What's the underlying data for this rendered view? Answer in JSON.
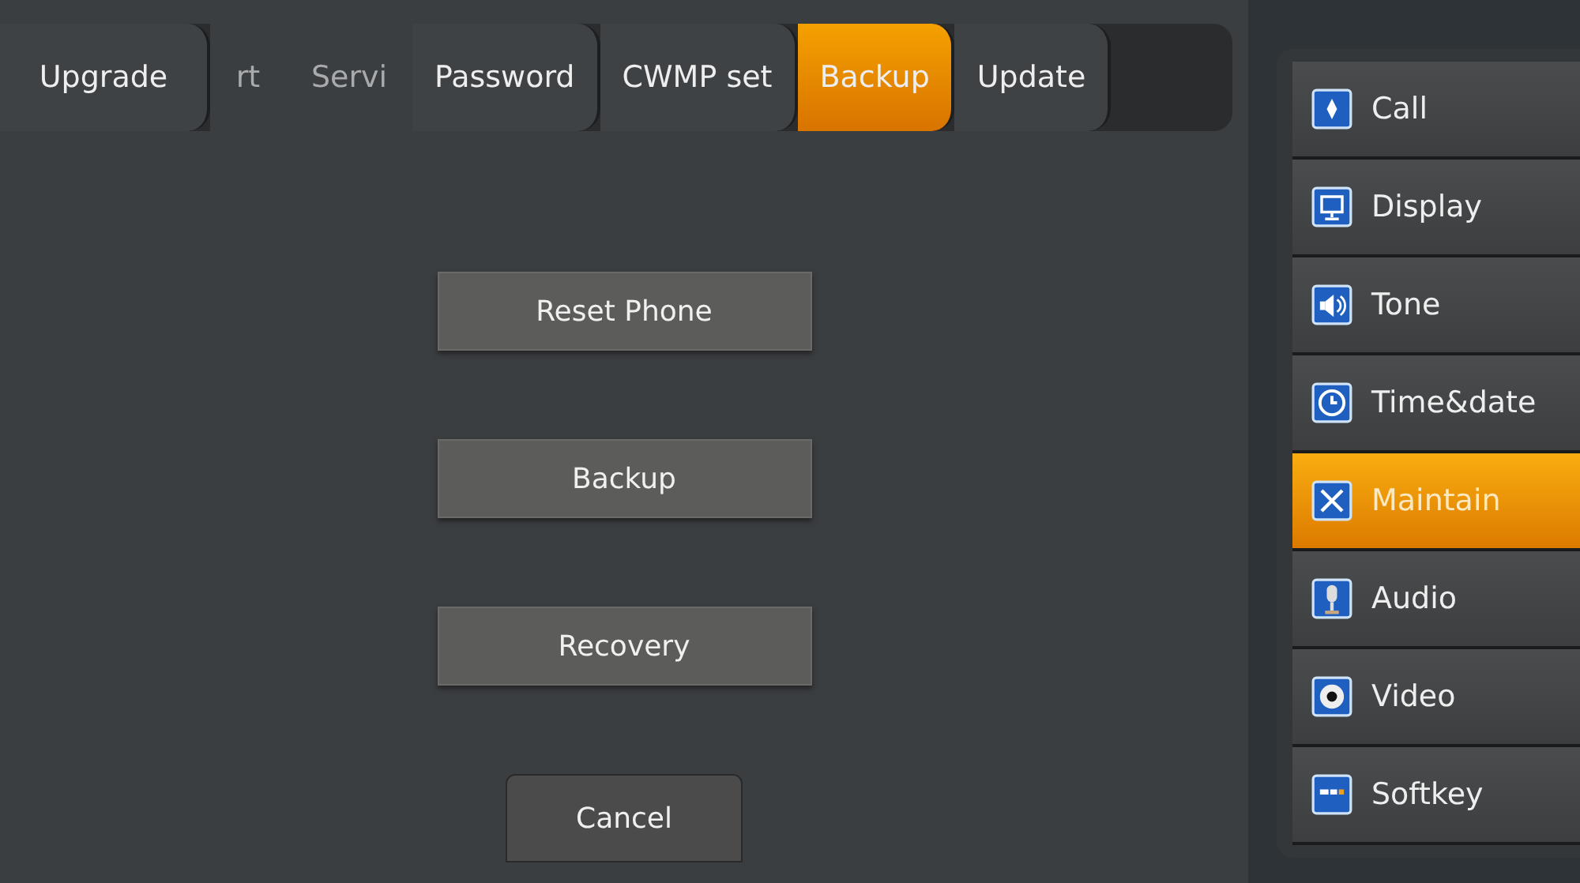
{
  "tabs": [
    {
      "label": "Upgrade",
      "selected": false,
      "kind": "full"
    },
    {
      "label": "rt",
      "selected": false,
      "kind": "partial"
    },
    {
      "label": "Servi",
      "selected": false,
      "kind": "partial"
    },
    {
      "label": "Password",
      "selected": false,
      "kind": "full"
    },
    {
      "label": "CWMP set",
      "selected": false,
      "kind": "full"
    },
    {
      "label": "Backup",
      "selected": true,
      "kind": "full"
    },
    {
      "label": "Update",
      "selected": false,
      "kind": "full"
    }
  ],
  "actions": [
    "Reset Phone",
    "Backup",
    "Recovery"
  ],
  "cancel": "Cancel",
  "menu": [
    {
      "label": "Call",
      "selected": false
    },
    {
      "label": "Display",
      "selected": false
    },
    {
      "label": "Tone",
      "selected": false
    },
    {
      "label": "Time&date",
      "selected": false
    },
    {
      "label": "Maintain",
      "selected": true
    },
    {
      "label": "Audio",
      "selected": false
    },
    {
      "label": "Video",
      "selected": false
    },
    {
      "label": "Softkey",
      "selected": false
    }
  ]
}
